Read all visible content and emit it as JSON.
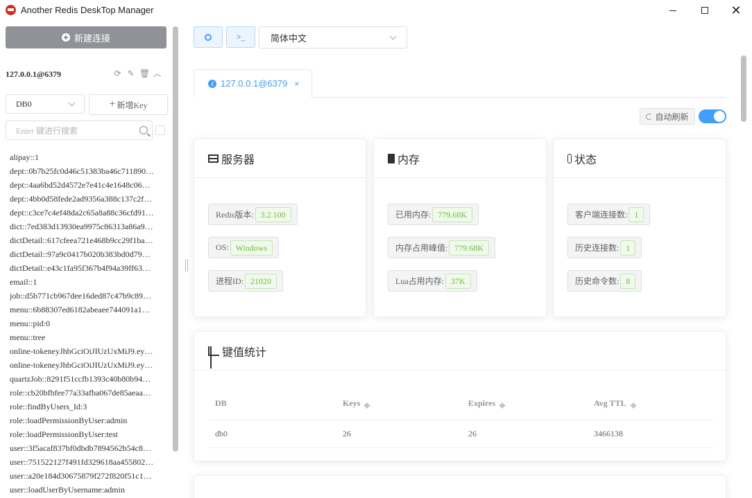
{
  "window": {
    "title": "Another Redis DeskTop Manager"
  },
  "sidebar": {
    "new_connection_label": "新建连接",
    "connection_name": "127.0.0.1@6379",
    "db_select_value": "DB0",
    "add_key_label": "新增Key",
    "search_placeholder": "Enter 键进行搜索",
    "keys": [
      "alipay::1",
      "dept::0b7b25fc0d46c51383ba46c711890…",
      "dept::4aa6bd52d4572e7e41c4e1648c06…",
      "dept::4bb0d58fede2ad9356a388c137c2f…",
      "dept::c3ce7c4ef48da2c65a8a88c36cfd91…",
      "dict::7ed383d13930ea9975c86313a86a9…",
      "dictDetail::617cfeea721e468b9cc29f1ba…",
      "dictDetail::97a9c0417b020b383bd0d79…",
      "dictDetail::e43c1fa95f367b4f94a39ff63…",
      "email::1",
      "job::d5b771cb967dee16ded87c47b9c89…",
      "menu::6b88307ed6182abeaee744091a1…",
      "menu::pid:0",
      "menu::tree",
      "online-tokeneyJhbGciOiJIUzUxMiJ9.ey…",
      "online-tokeneyJhbGciOiJIUzUxMiJ9.ey…",
      "quartzJob::8291f51ccfb1393c40b80b94…",
      "role::cb20bfbfee77a33afba067de85aeaa…",
      "role::findByUsers_Id:3",
      "role::loadPermissionByUser:admin",
      "role::loadPermissionByUser:test",
      "user::3f5acaf837bf0dbdb7894562b54c8…",
      "user::751522127f491fd329618aa455802…",
      "user::a20e184d30675879f272f820f51c1…",
      "user::loadUserByUsername:admin"
    ]
  },
  "toolbar": {
    "settings_icon": "gear-icon",
    "terminal_label": ">_",
    "language_value": "简体中文"
  },
  "tab": {
    "label": "127.0.0.1@6379",
    "close": "×"
  },
  "auto_refresh": {
    "label": "自动刷新",
    "enabled": true
  },
  "server": {
    "title": "服务器",
    "rows": [
      {
        "label": "Redis版本:",
        "value": "3.2.100"
      },
      {
        "label": "OS:",
        "value": "Windows"
      },
      {
        "label": "进程ID:",
        "value": "21020"
      }
    ]
  },
  "memory": {
    "title": "内存",
    "rows": [
      {
        "label": "已用内存:",
        "value": "779.68K"
      },
      {
        "label": "内存占用峰值:",
        "value": "779.68K"
      },
      {
        "label": "Lua占用内存:",
        "value": "37K"
      }
    ]
  },
  "status": {
    "title": "状态",
    "rows": [
      {
        "label": "客户端连接数:",
        "value": "1"
      },
      {
        "label": "历史连接数:",
        "value": "1"
      },
      {
        "label": "历史命令数:",
        "value": "8"
      }
    ]
  },
  "key_stats": {
    "title": "键值统计",
    "headers": [
      "DB",
      "Keys",
      "Expires",
      "Avg TTL"
    ],
    "rows": [
      [
        "db0",
        "26",
        "26",
        "3466138"
      ]
    ]
  },
  "colors": {
    "accent": "#409eff",
    "badge_green": "#67c23a",
    "new_conn_bg": "#8f9297"
  }
}
